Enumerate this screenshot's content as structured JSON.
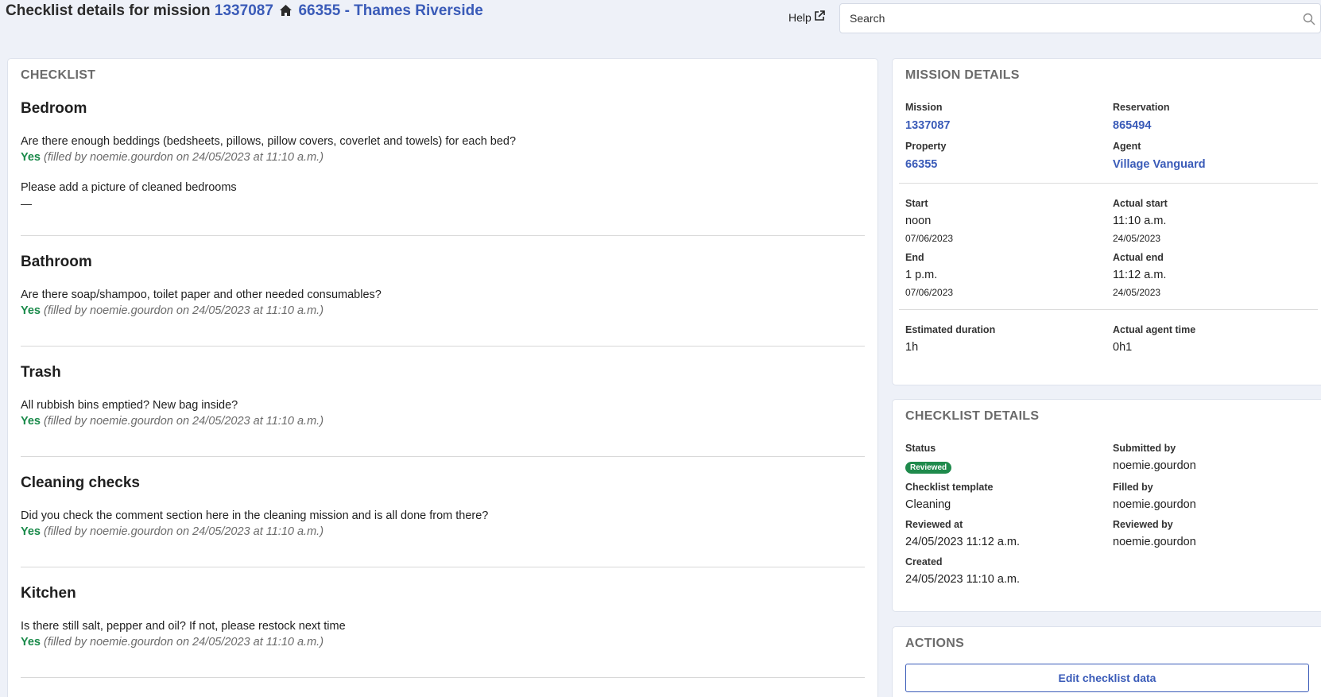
{
  "header": {
    "title_prefix": "Checklist details for mission",
    "mission_id": "1337087",
    "property_label": "66355 - Thames Riverside",
    "help_label": "Help",
    "search_placeholder": "Search"
  },
  "checklist": {
    "title": "CHECKLIST",
    "sections": [
      {
        "title": "Bedroom",
        "q1": "Are there enough beddings (bedsheets, pillows, pillow covers, coverlet and towels) for each bed?",
        "a1_value": "Yes",
        "a1_meta": "(filled by noemie.gourdon on 24/05/2023 at 11:10 a.m.)",
        "q2": "Please add a picture of cleaned bedrooms",
        "a2_value": "—"
      },
      {
        "title": "Bathroom",
        "q1": "Are there soap/shampoo, toilet paper and other needed consumables?",
        "a1_value": "Yes",
        "a1_meta": "(filled by noemie.gourdon on 24/05/2023 at 11:10 a.m.)"
      },
      {
        "title": "Trash",
        "q1": "All rubbish bins emptied? New bag inside?",
        "a1_value": "Yes",
        "a1_meta": "(filled by noemie.gourdon on 24/05/2023 at 11:10 a.m.)"
      },
      {
        "title": "Cleaning checks",
        "q1": "Did you check the comment section here in the cleaning mission and is all done from there?",
        "a1_value": "Yes",
        "a1_meta": "(filled by noemie.gourdon on 24/05/2023 at 11:10 a.m.)"
      },
      {
        "title": "Kitchen",
        "q1": "Is there still salt, pepper and oil? If not, please restock next time",
        "a1_value": "Yes",
        "a1_meta": "(filled by noemie.gourdon on 24/05/2023 at 11:10 a.m.)"
      }
    ]
  },
  "mission_details": {
    "title": "MISSION DETAILS",
    "mission_label": "Mission",
    "mission_value": "1337087",
    "reservation_label": "Reservation",
    "reservation_value": "865494",
    "property_label": "Property",
    "property_value": "66355",
    "agent_label": "Agent",
    "agent_value": "Village Vanguard",
    "start_label": "Start",
    "start_time": "noon",
    "start_date": "07/06/2023",
    "actual_start_label": "Actual start",
    "actual_start_time": "11:10 a.m.",
    "actual_start_date": "24/05/2023",
    "end_label": "End",
    "end_time": "1 p.m.",
    "end_date": "07/06/2023",
    "actual_end_label": "Actual end",
    "actual_end_time": "11:12 a.m.",
    "actual_end_date": "24/05/2023",
    "estimated_duration_label": "Estimated duration",
    "estimated_duration_value": "1h",
    "actual_agent_time_label": "Actual agent time",
    "actual_agent_time_value": "0h1"
  },
  "checklist_details": {
    "title": "CHECKLIST DETAILS",
    "status_label": "Status",
    "status_value": "Reviewed",
    "submitted_by_label": "Submitted by",
    "submitted_by_value": "noemie.gourdon",
    "template_label": "Checklist template",
    "template_value": "Cleaning",
    "filled_by_label": "Filled by",
    "filled_by_value": "noemie.gourdon",
    "reviewed_at_label": "Reviewed at",
    "reviewed_at_value": "24/05/2023 11:12 a.m.",
    "reviewed_by_label": "Reviewed by",
    "reviewed_by_value": "noemie.gourdon",
    "created_label": "Created",
    "created_value": "24/05/2023 11:10 a.m."
  },
  "actions": {
    "title": "ACTIONS",
    "edit_label": "Edit checklist data"
  },
  "colors": {
    "link": "#3a5bb8",
    "yes": "#1a8a4a",
    "badge": "#1f8a4c",
    "background": "#eef1f8"
  },
  "icons": {
    "home": "home-icon",
    "external": "external-link-icon",
    "search": "search-icon"
  }
}
